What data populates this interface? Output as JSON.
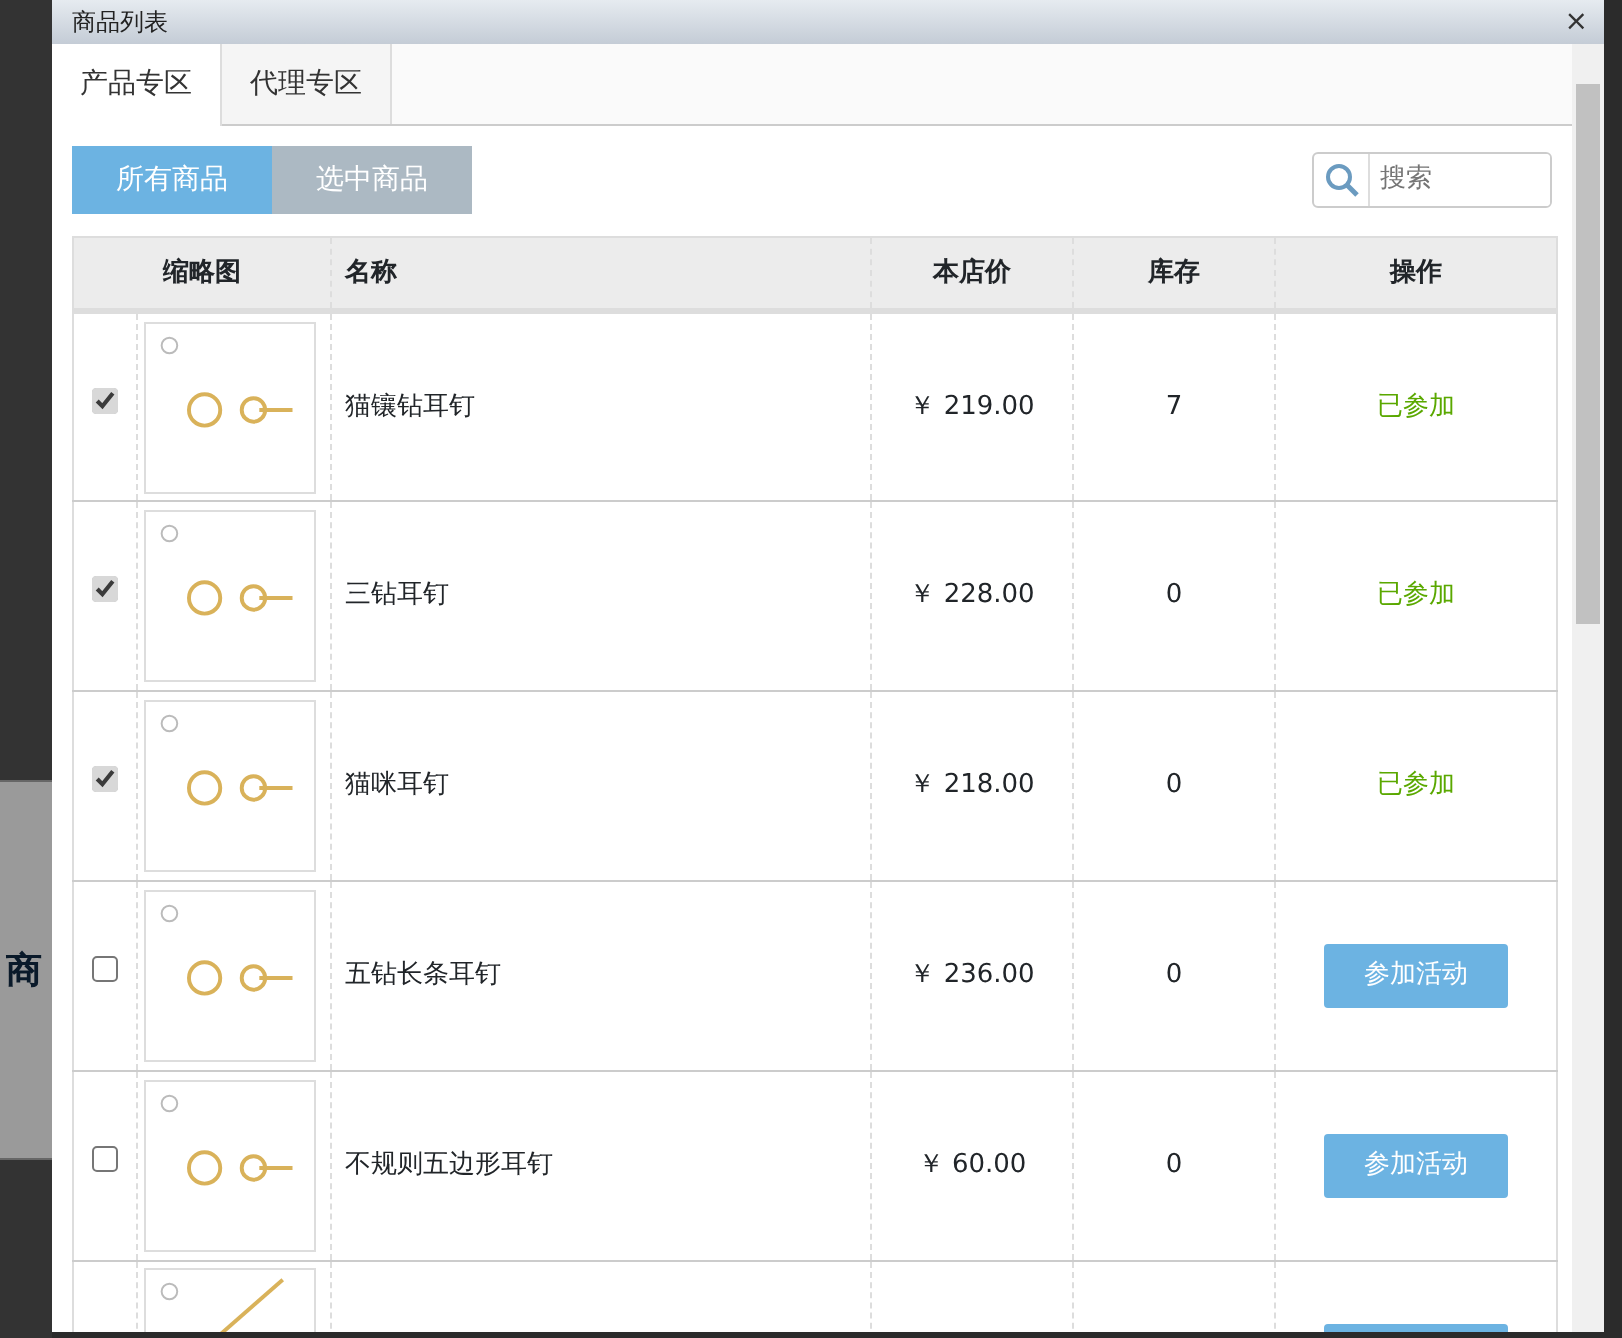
{
  "background": {
    "fragment": "商"
  },
  "window": {
    "title": "商品列表",
    "close": "×"
  },
  "tabs": [
    {
      "label": "产品专区",
      "selected": true
    },
    {
      "label": "代理专区",
      "selected": false
    }
  ],
  "filters": [
    {
      "label": "所有商品",
      "selected": true
    },
    {
      "label": "选中商品",
      "selected": false
    }
  ],
  "search": {
    "placeholder": "搜索"
  },
  "table": {
    "columns": [
      "缩略图",
      "名称",
      "本店价",
      "库存",
      "操作"
    ],
    "rows": [
      {
        "kind": "full",
        "checked": true,
        "name": "猫镶钻耳钉",
        "price": "￥ 219.00",
        "stock": "7",
        "action": {
          "kind": "status",
          "label": "已参加"
        }
      },
      {
        "kind": "full",
        "checked": true,
        "name": "三钻耳钉",
        "price": "￥ 228.00",
        "stock": "0",
        "action": {
          "kind": "status",
          "label": "已参加"
        }
      },
      {
        "kind": "full",
        "checked": true,
        "name": "猫咪耳钉",
        "price": "￥ 218.00",
        "stock": "0",
        "action": {
          "kind": "status",
          "label": "已参加"
        }
      },
      {
        "kind": "full",
        "checked": false,
        "name": "五钻长条耳钉",
        "price": "￥ 236.00",
        "stock": "0",
        "action": {
          "kind": "button",
          "label": "参加活动"
        }
      },
      {
        "kind": "full",
        "checked": false,
        "name": "不规则五边形耳钉",
        "price": "￥ 60.00",
        "stock": "0",
        "action": {
          "kind": "button",
          "label": "参加活动"
        }
      },
      {
        "kind": "cut"
      }
    ]
  }
}
